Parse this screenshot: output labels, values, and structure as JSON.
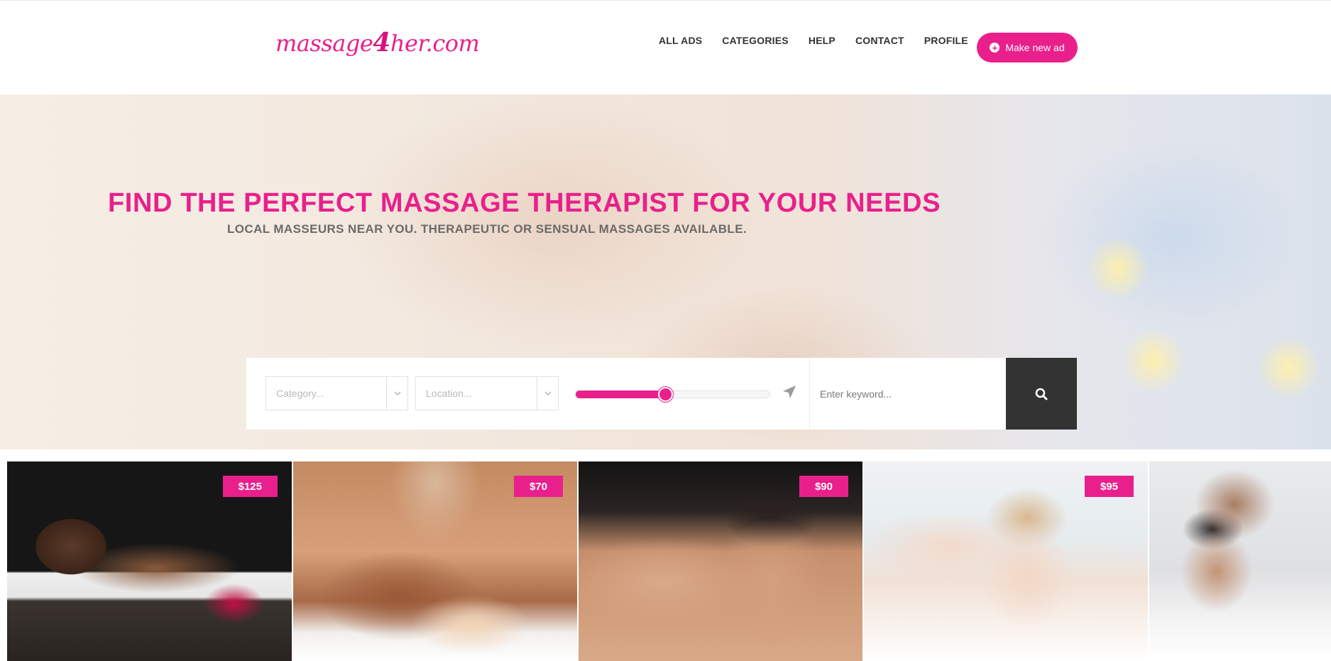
{
  "header": {
    "logo": {
      "prefix": "massage",
      "four": "4",
      "suffix": "her.com"
    },
    "nav": [
      "ALL ADS",
      "CATEGORIES",
      "HELP",
      "CONTACT",
      "PROFILE"
    ],
    "cta_label": "Make new ad"
  },
  "hero": {
    "title": "FIND THE PERFECT MASSAGE THERAPIST FOR YOUR NEEDS",
    "subtitle": "LOCAL MASSEURS NEAR YOU. THERAPEUTIC OR SENSUAL MASSAGES AVAILABLE."
  },
  "search": {
    "category_placeholder": "Category...",
    "location_placeholder": "Location...",
    "radius_fraction": 0.46,
    "keyword_placeholder": "Enter keyword...",
    "icons": {
      "dropdown": "chevron-down-icon",
      "locate": "location-arrow-icon",
      "submit": "search-icon"
    }
  },
  "listings": [
    {
      "price": "$125"
    },
    {
      "price": "$70"
    },
    {
      "price": "$90"
    },
    {
      "price": "$95"
    },
    {
      "price": ""
    }
  ],
  "colors": {
    "accent": "#e9208c",
    "dark": "#333333",
    "nav_text": "#333333"
  }
}
